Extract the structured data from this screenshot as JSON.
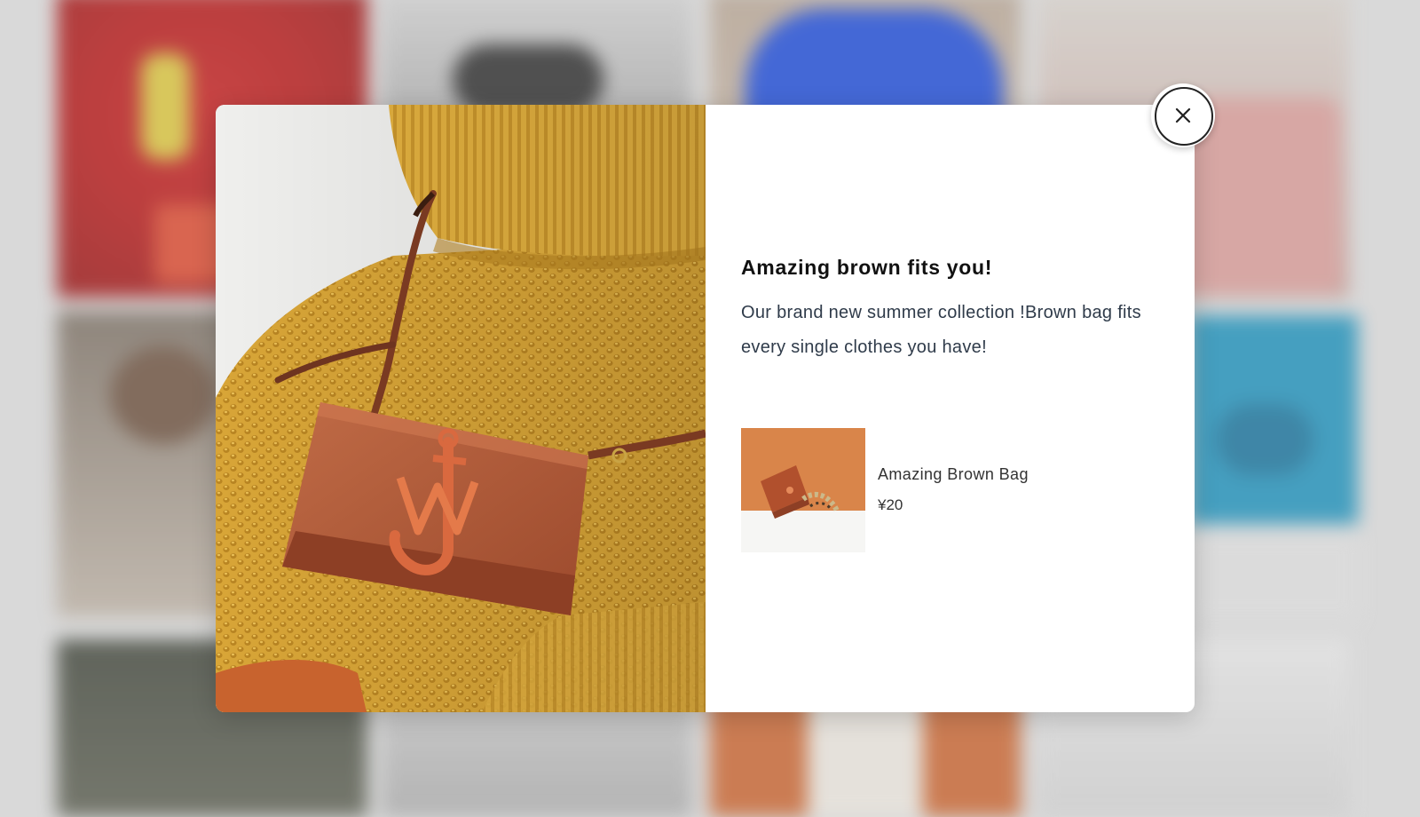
{
  "modal": {
    "title": "Amazing brown fits you!",
    "description": "Our brand new summer collection !Brown bag fits every single clothes you have!",
    "hero_image": "model-in-mustard-sweater-with-brown-crossbody-bag",
    "close_icon": "close-icon",
    "product": {
      "name": "Amazing Brown Bag",
      "price": "¥20",
      "thumbnail": "brown-bag-thumbnail"
    }
  },
  "colors": {
    "sweater": "#d8a537",
    "bag": "#b65e3b",
    "text_dark": "#111111",
    "text_body": "#2f3b4a"
  }
}
